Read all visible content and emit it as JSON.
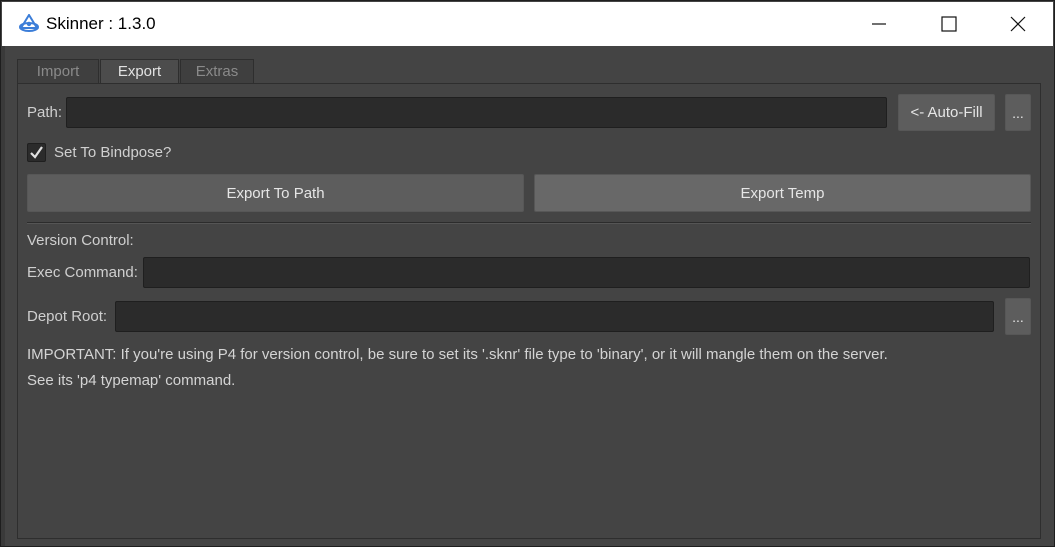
{
  "window": {
    "title": "Skinner : 1.3.0",
    "icon": "skinner-app-icon",
    "controls": [
      "minimize-icon",
      "maximize-icon",
      "close-icon"
    ]
  },
  "tabs": [
    {
      "label": "Import",
      "active": false
    },
    {
      "label": "Export",
      "active": true
    },
    {
      "label": "Extras",
      "active": false
    }
  ],
  "export": {
    "path_label": "Path:",
    "path_value": "",
    "autofill_label": "<- Auto-Fill",
    "browse_label": "...",
    "bindpose_label": "Set To Bindpose?",
    "bindpose_checked": true,
    "export_path_label": "Export To Path",
    "export_temp_label": "Export Temp"
  },
  "version_control": {
    "heading": "Version Control:",
    "exec_label": "Exec Command:",
    "exec_value": "",
    "depot_label": "Depot Root:",
    "depot_value": "",
    "depot_browse_label": "...",
    "note_line1": "IMPORTANT: If you're using P4 for version control, be sure to set its '.sknr' file type to 'binary', or it will mangle them on the server.",
    "note_line2": "See its 'p4 typemap' command."
  },
  "colors": {
    "background": "#444444",
    "field": "#2b2b2b",
    "button": "#5d5d5d",
    "text": "#cfcfcf",
    "titlebar": "#ffffff",
    "icon_accent": "#3b7dd8"
  }
}
